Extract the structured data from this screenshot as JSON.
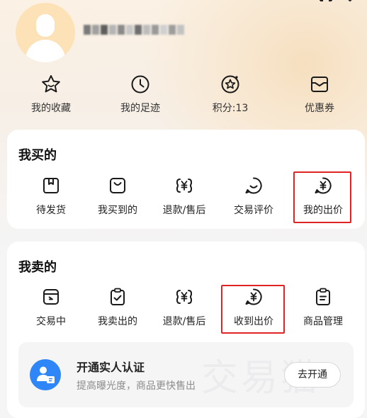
{
  "header": {
    "username": "",
    "colors": {
      "avatar_bg": "#fde2b8",
      "username_blur": [
        "#7a7a7a",
        "#a0a0a0",
        "#5e5e5e",
        "#b5b5b5",
        "#8a8a8a",
        "#c7c7c7",
        "#6f6f6f",
        "#bdbdbd",
        "#999999",
        "#d0d0d0",
        "#9d9d9d",
        "#c2c2c2"
      ]
    }
  },
  "quick_links": [
    {
      "label": "我的收藏",
      "icon": "star-icon"
    },
    {
      "label": "我的足迹",
      "icon": "clock-icon"
    },
    {
      "label": "积分:13",
      "icon": "points-star-icon"
    },
    {
      "label": "优惠券",
      "icon": "coupon-icon"
    }
  ],
  "buy_section": {
    "title": "我买的",
    "items": [
      {
        "label": "待发货",
        "icon": "box-icon"
      },
      {
        "label": "我买到的",
        "icon": "bag-icon"
      },
      {
        "label": "退款/售后",
        "icon": "yuan-refund-icon"
      },
      {
        "label": "交易评价",
        "icon": "chat-smile-icon"
      },
      {
        "label": "我的出价",
        "icon": "yuan-bubble-icon",
        "highlighted": true
      }
    ]
  },
  "sell_section": {
    "title": "我卖的",
    "items": [
      {
        "label": "交易中",
        "icon": "trading-box-icon"
      },
      {
        "label": "我卖出的",
        "icon": "clipboard-check-icon"
      },
      {
        "label": "退款/售后",
        "icon": "yuan-refund-icon"
      },
      {
        "label": "收到出价",
        "icon": "yuan-bubble-icon",
        "highlighted": true
      },
      {
        "label": "商品管理",
        "icon": "clipboard-list-icon"
      }
    ]
  },
  "verification": {
    "title": "开通实人认证",
    "subtitle": "提高曝光度，商品更快售出",
    "button": "去开通",
    "watermark": "交易猫",
    "icon": "id-card-icon"
  },
  "colors": {
    "highlight_box": "#e02323",
    "accent_blue": "#2f86f6",
    "icon_stroke": "#1a1a1a"
  }
}
